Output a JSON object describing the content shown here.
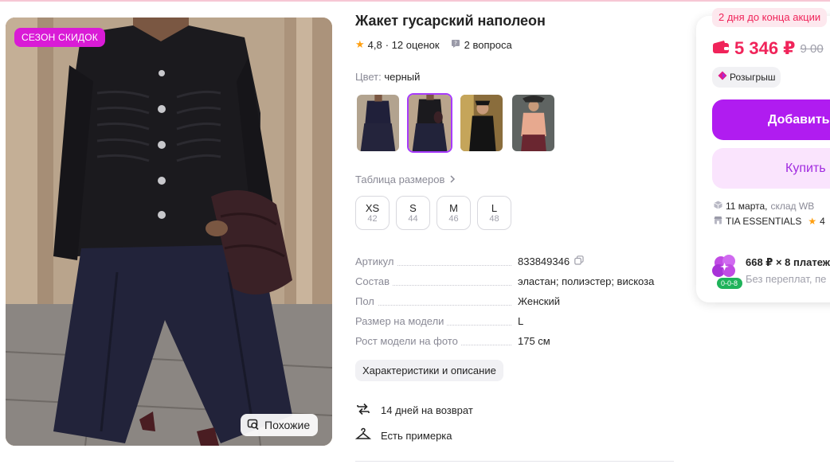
{
  "product": {
    "title": "Жакет гусарский наполеон",
    "rating": "4,8",
    "reviews": "· 12 оценок",
    "questions": "2 вопроса",
    "color_label": "Цвет:",
    "color_value": "черный"
  },
  "gallery": {
    "promo_badge": "СЕЗОН СКИДОК",
    "similar_button": "Похожие"
  },
  "size_table_link": "Таблица размеров",
  "sizes": [
    {
      "size": "XS",
      "ru": "42"
    },
    {
      "size": "S",
      "ru": "44"
    },
    {
      "size": "M",
      "ru": "46"
    },
    {
      "size": "L",
      "ru": "48"
    }
  ],
  "specs": [
    {
      "key": "Артикул",
      "value": "833849346"
    },
    {
      "key": "Состав",
      "value": "эластан; полиэстер; вискоза"
    },
    {
      "key": "Пол",
      "value": "Женский"
    },
    {
      "key": "Размер на модели",
      "value": "L"
    },
    {
      "key": "Рост модели на фото",
      "value": "175 см"
    }
  ],
  "description_button": "Характеристики и описание",
  "features": {
    "return": "14 дней на возврат",
    "fitting": "Есть примерка"
  },
  "purchase": {
    "deadline": "2 дня до конца акции",
    "price": "5 346 ₽",
    "old_price": "9 00",
    "raffle": "Розыгрыш",
    "add_button": "Добавить",
    "buy_button": "Купить",
    "delivery_date": "11 марта,",
    "delivery_warehouse": "склад WB",
    "seller": "TIA ESSENTIALS",
    "seller_rating": "4",
    "installment_title": "668 ₽ × 8 платеж",
    "installment_sub": "Без переплат, пе",
    "installment_badge": "0-0-8"
  },
  "colors": {
    "accent": "#a73afd",
    "price": "#f0245a",
    "promo": "#d91bd6",
    "primary_button": "#b01cf0"
  }
}
